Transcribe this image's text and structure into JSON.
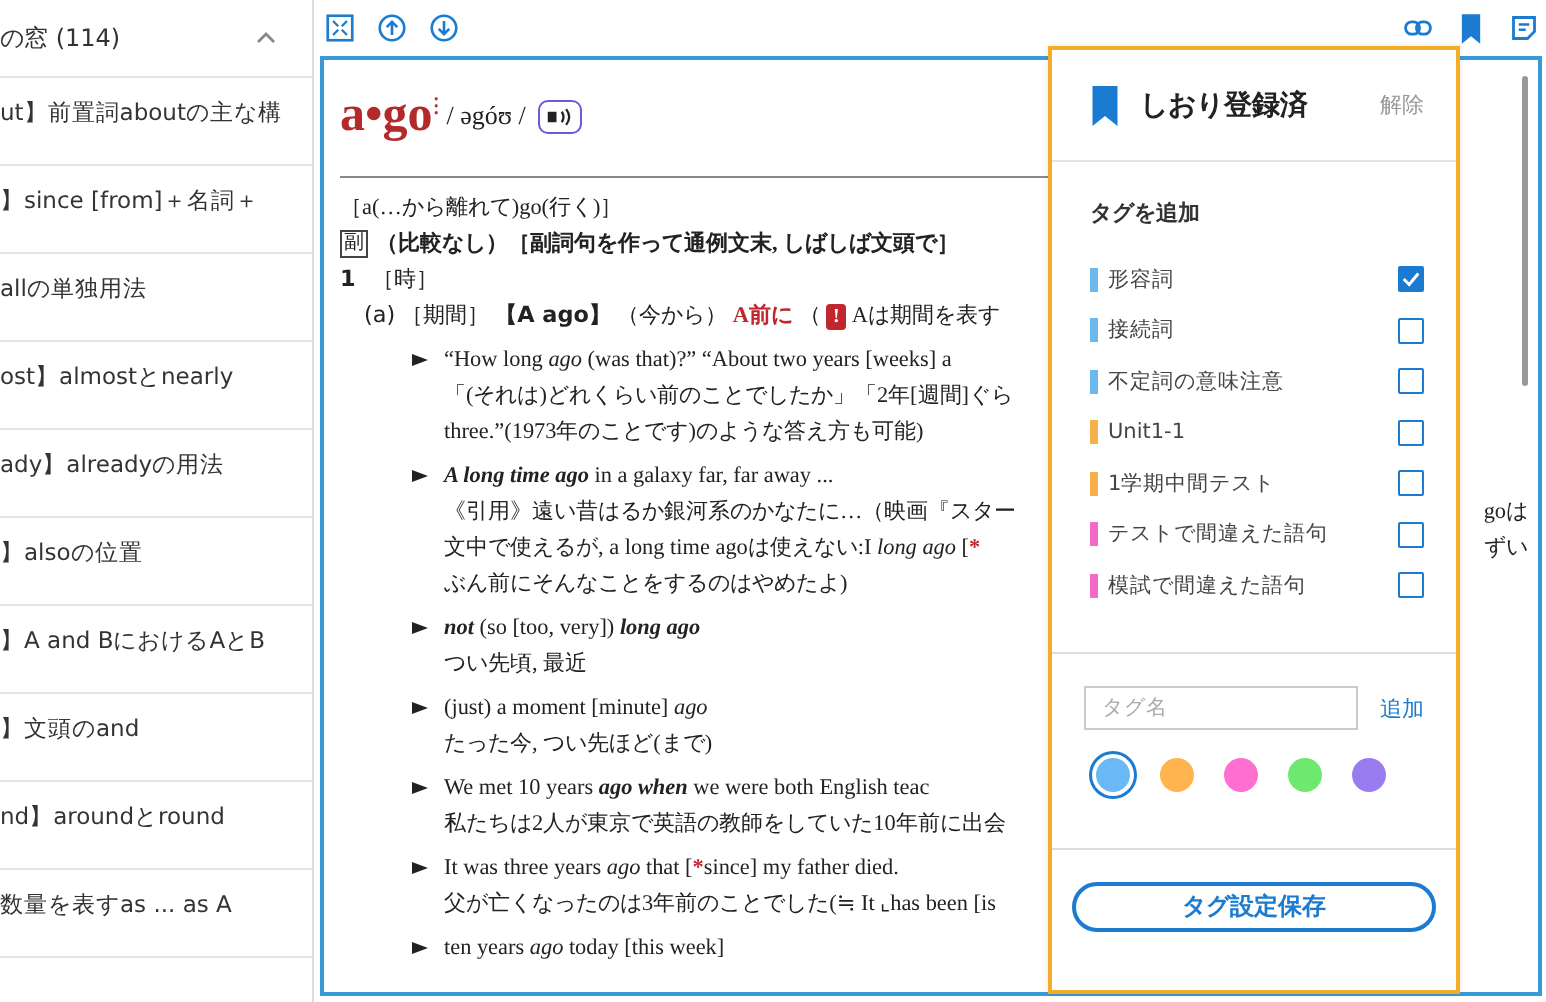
{
  "sidebar": {
    "title": "の窓 (114)",
    "expanded": true,
    "items": [
      {
        "label": "ut】前置詞aboutの主な構"
      },
      {
        "label": "】since [from]＋名詞＋"
      },
      {
        "label": "allの単独用法"
      },
      {
        "label": "ost】almostとnearly"
      },
      {
        "label": "ady】alreadyの用法"
      },
      {
        "label": "】alsoの位置"
      },
      {
        "label": "】A and BにおけるAとB"
      },
      {
        "label": "】文頭のand"
      },
      {
        "label": "nd】aroundとround"
      },
      {
        "label": "数量を表すas ... as A"
      }
    ]
  },
  "entry": {
    "headword": "a•go",
    "mark": "⁝",
    "pronunciation": "/ əgóʊ /",
    "etymology": "［a(…から離れて)go(行く)］",
    "pos": "副",
    "pos_note": "（比較なし）［副詞句を作って通例文末, しばしば文頭で］",
    "sense_number": "1",
    "sense_label": "［時］",
    "subsense": [
      {
        "t": "(a)",
        "kind": "sans"
      },
      {
        "t": "［期間］",
        "kind": "plain"
      },
      {
        "t": "【A ago】",
        "kind": "bold"
      },
      {
        "t": "（今から）",
        "kind": "plain"
      },
      {
        "t": "A前に",
        "kind": "red"
      },
      {
        "t": "（",
        "kind": "plain"
      },
      {
        "t": "!",
        "kind": "alert"
      },
      {
        "t": "Aは期間を表す",
        "kind": "plain"
      }
    ],
    "examples": [
      {
        "lines": [
          {
            "segs": [
              {
                "t": "“How long ",
                "kind": "plain"
              },
              {
                "t": "ago",
                "kind": "italic"
              },
              {
                "t": " (was that)?” “About two years [weeks] a",
                "kind": "plain"
              }
            ]
          },
          {
            "segs": [
              {
                "t": "「(それは)どれくらい前のことでしたか」「2年[週間]ぐら",
                "kind": "plain"
              }
            ]
          },
          {
            "segs": [
              {
                "t": "three.”(1973年のことです)のような答え方も可能)",
                "kind": "plain"
              }
            ]
          }
        ]
      },
      {
        "lines": [
          {
            "segs": [
              {
                "t": "A long time ago",
                "kind": "bold-italic"
              },
              {
                "t": " in a galaxy far, far away ...",
                "kind": "plain"
              }
            ]
          },
          {
            "segs": [
              {
                "t": "《引用》遠い昔はるか銀河系のかなたに…（映画『スター",
                "kind": "plain"
              }
            ],
            "tail": "goは"
          },
          {
            "segs": [
              {
                "t": "文中で使えるが, a long time agoは使えない:I ",
                "kind": "plain"
              },
              {
                "t": "long ago",
                "kind": "italic"
              },
              {
                "t": " [",
                "kind": "plain"
              },
              {
                "t": "*",
                "kind": "red"
              }
            ],
            "tail": "ずい"
          },
          {
            "segs": [
              {
                "t": "ぶん前にそんなことをするのはやめたよ)",
                "kind": "plain"
              }
            ]
          }
        ]
      },
      {
        "lines": [
          {
            "segs": [
              {
                "t": "not",
                "kind": "bold-italic"
              },
              {
                "t": " (so [too, very]) ",
                "kind": "plain"
              },
              {
                "t": "long ago",
                "kind": "bold-italic"
              }
            ]
          },
          {
            "segs": [
              {
                "t": "つい先頃, 最近",
                "kind": "plain"
              }
            ]
          }
        ]
      },
      {
        "lines": [
          {
            "segs": [
              {
                "t": "(just) a moment [minute] ",
                "kind": "plain"
              },
              {
                "t": "ago",
                "kind": "italic"
              }
            ]
          },
          {
            "segs": [
              {
                "t": "たった今, つい先ほど(まで)",
                "kind": "plain"
              }
            ]
          }
        ]
      },
      {
        "lines": [
          {
            "segs": [
              {
                "t": "We met 10 years ",
                "kind": "plain"
              },
              {
                "t": "ago when",
                "kind": "bold-italic"
              },
              {
                "t": " we were both English teac",
                "kind": "plain"
              }
            ]
          },
          {
            "segs": [
              {
                "t": "私たちは2人が東京で英語の教師をしていた10年前に出会",
                "kind": "plain"
              }
            ]
          }
        ]
      },
      {
        "lines": [
          {
            "segs": [
              {
                "t": "It was three years ",
                "kind": "plain"
              },
              {
                "t": "ago",
                "kind": "italic"
              },
              {
                "t": " that [",
                "kind": "plain"
              },
              {
                "t": "*",
                "kind": "red"
              },
              {
                "t": "since] my father died.",
                "kind": "plain"
              }
            ]
          },
          {
            "segs": [
              {
                "t": "父が亡くなったのは3年前のことでした(≒ It ⌞has been [is",
                "kind": "plain"
              }
            ]
          }
        ]
      },
      {
        "lines": [
          {
            "segs": [
              {
                "t": "ten years ",
                "kind": "plain"
              },
              {
                "t": "ago",
                "kind": "italic"
              },
              {
                "t": " today [this week]",
                "kind": "plain"
              }
            ]
          }
        ]
      }
    ]
  },
  "popup": {
    "title": "しおり登録済",
    "remove": "解除",
    "add_heading": "タグを追加",
    "tags": [
      {
        "label": "形容詞",
        "color": "#6cb8ef",
        "checked": true
      },
      {
        "label": "接続詞",
        "color": "#6cb8ef",
        "checked": false
      },
      {
        "label": "不定詞の意味注意",
        "color": "#6cb8ef",
        "checked": false
      },
      {
        "label": "Unit1-1",
        "color": "#f8b04a",
        "checked": false
      },
      {
        "label": "1学期中間テスト",
        "color": "#f8b04a",
        "checked": false
      },
      {
        "label": "テストで間違えた語句",
        "color": "#f06cc8",
        "checked": false
      },
      {
        "label": "模試で間違えた語句",
        "color": "#f06cc8",
        "checked": false
      }
    ],
    "new_tag": {
      "placeholder": "タグ名"
    },
    "add_button": "追加",
    "colors": [
      {
        "color": "#6ab8f5",
        "selected": true
      },
      {
        "color": "#ffb44f",
        "selected": false
      },
      {
        "color": "#ff6fd0",
        "selected": false
      },
      {
        "color": "#6ee86e",
        "selected": false
      },
      {
        "color": "#9b7cf0",
        "selected": false
      }
    ],
    "save_button": "タグ設定保存"
  }
}
